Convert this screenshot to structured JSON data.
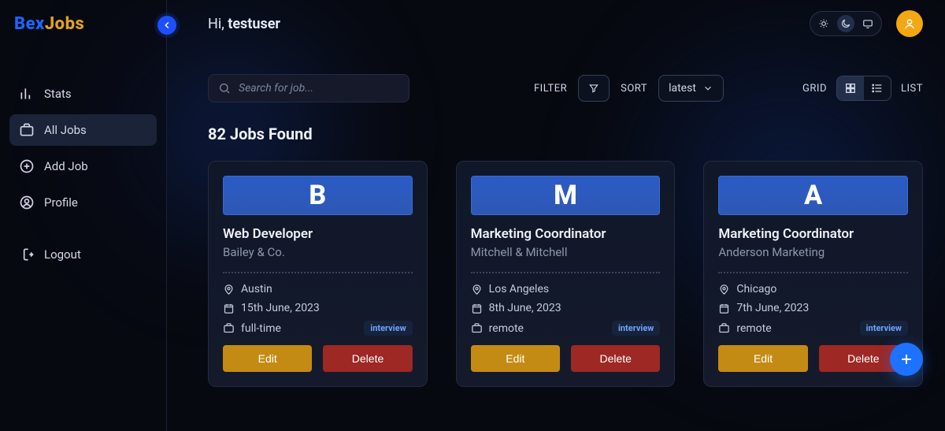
{
  "brand": {
    "part1": "Bex",
    "part2": "Jobs"
  },
  "greeting": {
    "prefix": "Hi, ",
    "username": "testuser"
  },
  "sidebar": {
    "items": [
      {
        "label": "Stats"
      },
      {
        "label": "All Jobs"
      },
      {
        "label": "Add Job"
      },
      {
        "label": "Profile"
      }
    ],
    "logout": "Logout"
  },
  "search": {
    "placeholder": "Search for job..."
  },
  "controls": {
    "filter_label": "FILTER",
    "sort_label": "SORT",
    "sort_value": "latest",
    "grid_label": "GRID",
    "list_label": "LIST"
  },
  "count": "82 Jobs Found",
  "cards": [
    {
      "letter": "B",
      "title": "Web Developer",
      "company": "Bailey & Co.",
      "location": "Austin",
      "date": "15th June, 2023",
      "type": "full-time",
      "status": "interview",
      "edit": "Edit",
      "delete": "Delete"
    },
    {
      "letter": "M",
      "title": "Marketing Coordinator",
      "company": "Mitchell & Mitchell",
      "location": "Los Angeles",
      "date": "8th June, 2023",
      "type": "remote",
      "status": "interview",
      "edit": "Edit",
      "delete": "Delete"
    },
    {
      "letter": "A",
      "title": "Marketing Coordinator",
      "company": "Anderson Marketing",
      "location": "Chicago",
      "date": "7th June, 2023",
      "type": "remote",
      "status": "interview",
      "edit": "Edit",
      "delete": "Delete"
    }
  ]
}
